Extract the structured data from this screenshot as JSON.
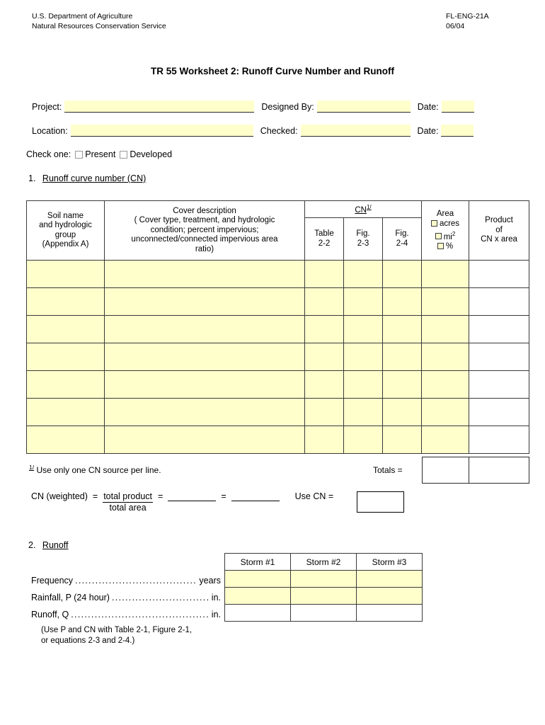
{
  "header": {
    "agency_line1": "U.S. Department of Agriculture",
    "agency_line2": "Natural Resources Conservation Service",
    "form_id": "FL-ENG-21A",
    "form_date": "06/04",
    "title": "TR 55 Worksheet 2:  Runoff Curve Number and Runoff"
  },
  "fields": {
    "project_label": "Project:",
    "project_value": "",
    "designed_by_label": "Designed By:",
    "designed_by_value": "",
    "date1_label": "Date:",
    "date1_value": "",
    "location_label": "Location:",
    "location_value": "",
    "checked_label": "Checked:",
    "checked_value": "",
    "date2_label": "Date:",
    "date2_value": "",
    "check_one_label": "Check one:",
    "present_label": "Present",
    "developed_label": "Developed"
  },
  "section1": {
    "number": "1.",
    "title": "Runoff curve number (CN)",
    "columns": {
      "soil": "Soil name\nand hydrologic\ngroup\n(Appendix A)",
      "soil_l1": "Soil name",
      "soil_l2": "and hydrologic",
      "soil_l3": "group",
      "soil_l4": "(Appendix A)",
      "cover_l1": "Cover description",
      "cover_l2": "( Cover type, treatment, and hydrologic",
      "cover_l3": "condition; percent impervious;",
      "cover_l4": "unconnected/connected impervious area",
      "cover_l5": "ratio)",
      "cn_group": "CN",
      "cn_group_sup": "1/",
      "cn_table22_l1": "Table",
      "cn_table22_l2": "2-2",
      "cn_fig23_l1": "Fig.",
      "cn_fig23_l2": "2-3",
      "cn_fig24_l1": "Fig.",
      "cn_fig24_l2": "2-4",
      "area_title": "Area",
      "area_opt_acres": "acres",
      "area_opt_mi": "mi",
      "area_opt_mi_sup": "2",
      "area_opt_pct": "%",
      "product_l1": "Product",
      "product_l2": "of",
      "product_l3": "CN x area"
    },
    "rows": [
      {
        "soil": "",
        "cover": "",
        "table22": "",
        "fig23": "",
        "fig24": "",
        "area": "",
        "product": ""
      },
      {
        "soil": "",
        "cover": "",
        "table22": "",
        "fig23": "",
        "fig24": "",
        "area": "",
        "product": ""
      },
      {
        "soil": "",
        "cover": "",
        "table22": "",
        "fig23": "",
        "fig24": "",
        "area": "",
        "product": ""
      },
      {
        "soil": "",
        "cover": "",
        "table22": "",
        "fig23": "",
        "fig24": "",
        "area": "",
        "product": ""
      },
      {
        "soil": "",
        "cover": "",
        "table22": "",
        "fig23": "",
        "fig24": "",
        "area": "",
        "product": ""
      },
      {
        "soil": "",
        "cover": "",
        "table22": "",
        "fig23": "",
        "fig24": "",
        "area": "",
        "product": ""
      },
      {
        "soil": "",
        "cover": "",
        "table22": "",
        "fig23": "",
        "fig24": "",
        "area": "",
        "product": ""
      }
    ],
    "footnote_mark": "1/",
    "footnote_text": "Use only one CN source per line.",
    "totals_label": "Totals  =",
    "totals_area_value": "",
    "totals_product_value": "",
    "weighted": {
      "label": "CN (weighted)",
      "eq1": "=",
      "numerator": "total product",
      "denominator": "total area",
      "eq2": "=",
      "value1": "",
      "eq3": "=",
      "value2": "",
      "use_cn_label": "Use CN  =",
      "use_cn_value": ""
    }
  },
  "section2": {
    "number": "2.",
    "title": "Runoff",
    "labels": [
      {
        "name": "Frequency",
        "unit": "years"
      },
      {
        "name": "Rainfall, P (24 hour)",
        "unit": "in."
      },
      {
        "name": "Runoff, Q",
        "unit": "in."
      }
    ],
    "note_l1": "(Use P and CN with Table 2-1, Figure 2-1,",
    "note_l2": "or equations 2-3 and 2-4.)",
    "storm_headers": [
      "Storm #1",
      "Storm #2",
      "Storm #3"
    ],
    "storm_rows": [
      {
        "values": [
          "",
          "",
          ""
        ]
      },
      {
        "values": [
          "",
          "",
          ""
        ]
      },
      {
        "values": [
          "",
          "",
          ""
        ]
      }
    ]
  },
  "colors": {
    "field_fill": "#FFFFCC",
    "border": "#3a3a3a",
    "text": "#000000"
  }
}
